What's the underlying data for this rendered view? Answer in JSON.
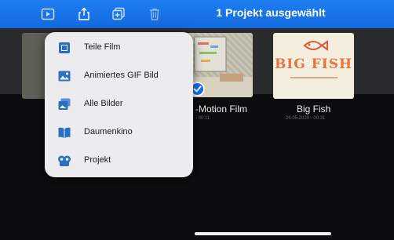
{
  "header": {
    "title": "1 Projekt ausgewählt",
    "icons": [
      "play-icon",
      "share-icon",
      "duplicate-icon",
      "trash-icon"
    ]
  },
  "menu": {
    "items": [
      {
        "label": "Teile Film",
        "icon": "film-icon"
      },
      {
        "label": "Animiertes GIF Bild",
        "icon": "image-icon"
      },
      {
        "label": "Alle Bilder",
        "icon": "photos-icon"
      },
      {
        "label": "Daumenkino",
        "icon": "book-icon"
      },
      {
        "label": "Projekt",
        "icon": "project-icon"
      }
    ]
  },
  "projects": [
    {
      "title": "-Motion Film",
      "meta": "- 00:11",
      "selected": true
    },
    {
      "title": "Big Fish",
      "meta": "26.05.2020 - 00:31",
      "poster_text": "BIG FISH",
      "selected": false
    }
  ],
  "colors": {
    "accent": "#1a72f0",
    "menu_bg": "#ececee"
  }
}
